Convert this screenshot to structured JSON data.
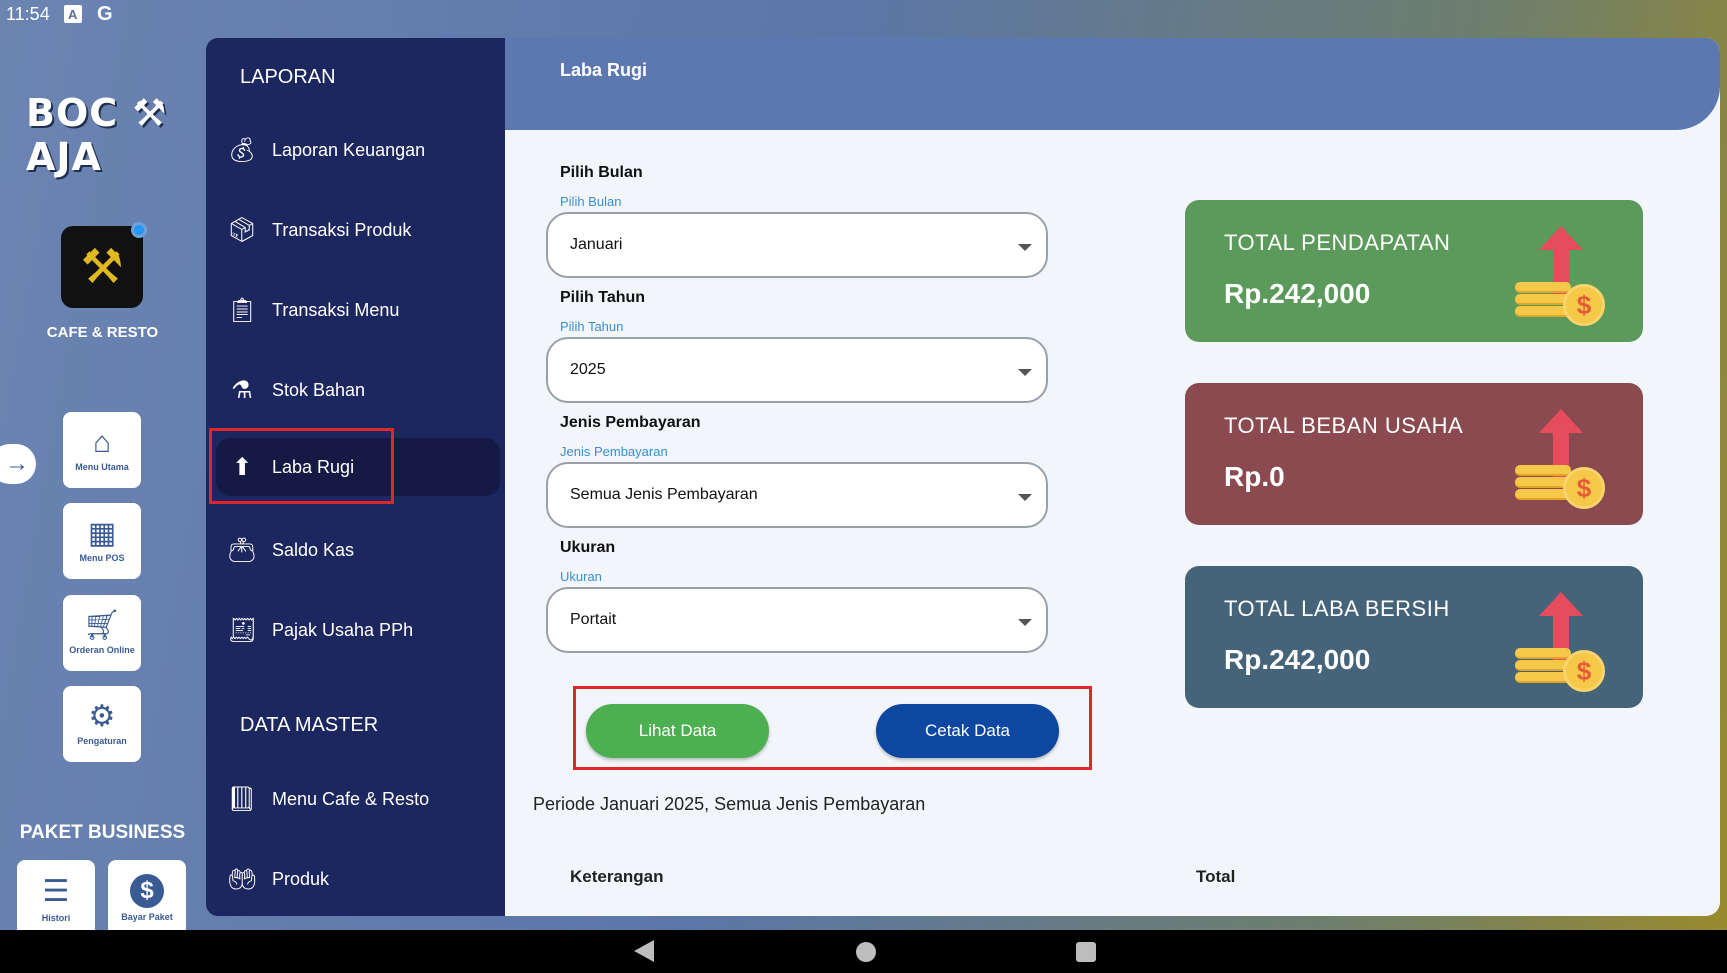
{
  "status_bar": {
    "time": "11:54",
    "icons": [
      "a-icon",
      "google-icon"
    ]
  },
  "rail": {
    "brand": "BOC ⚒ AJA",
    "caption": "CAFE & RESTO",
    "tiles": [
      {
        "label": "Menu Utama",
        "icon": "home-icon"
      },
      {
        "label": "Menu POS",
        "icon": "store-icon"
      },
      {
        "label": "Orderan Online",
        "icon": "cart-icon"
      },
      {
        "label": "Pengaturan",
        "icon": "gear-icon"
      }
    ],
    "paket": "PAKET BUSINESS",
    "bottom_tiles": [
      {
        "label": "Histori",
        "icon": "list-icon"
      },
      {
        "label": "Bayar Paket",
        "icon": "dollar-icon"
      }
    ]
  },
  "sidebar": {
    "laporan_title": "LAPORAN",
    "laporan_items": [
      {
        "label": "Laporan Keuangan",
        "icon": "money-bag-icon"
      },
      {
        "label": "Transaksi Produk",
        "icon": "box-icon"
      },
      {
        "label": "Transaksi Menu",
        "icon": "menu-board-icon"
      },
      {
        "label": "Stok Bahan",
        "icon": "ingredients-icon"
      },
      {
        "label": "Laba Rugi",
        "icon": "coins-up-icon"
      },
      {
        "label": "Saldo Kas",
        "icon": "wallet-icon"
      },
      {
        "label": "Pajak Usaha PPh",
        "icon": "tax-document-icon"
      }
    ],
    "master_title": "DATA MASTER",
    "master_items": [
      {
        "label": "Menu Cafe & Resto",
        "icon": "menu-book-icon"
      },
      {
        "label": "Produk",
        "icon": "product-hands-icon"
      }
    ]
  },
  "main": {
    "title": "Laba Rugi",
    "fields": {
      "bulan": {
        "label": "Pilih Bulan",
        "float": "Pilih Bulan",
        "value": "Januari"
      },
      "tahun": {
        "label": "Pilih Tahun",
        "float": "Pilih Tahun",
        "value": "2025"
      },
      "pembayaran": {
        "label": "Jenis Pembayaran",
        "float": "Jenis Pembayaran",
        "value": "Semua Jenis Pembayaran"
      },
      "ukuran": {
        "label": "Ukuran",
        "float": "Ukuran",
        "value": "Portait"
      }
    },
    "buttons": {
      "lihat": "Lihat Data",
      "cetak": "Cetak Data"
    },
    "periode": "Periode Januari 2025, Semua Jenis Pembayaran",
    "table_headers": {
      "keterangan": "Keterangan",
      "total": "Total"
    },
    "cards": [
      {
        "title": "TOTAL PENDAPATAN",
        "value": "Rp.242,000",
        "color": "#5b9a5a"
      },
      {
        "title": "TOTAL BEBAN USAHA",
        "value": "Rp.0",
        "color": "#8b4a4f"
      },
      {
        "title": "TOTAL LABA BERSIH",
        "value": "Rp.242,000",
        "color": "#456379"
      }
    ]
  },
  "colors": {
    "sidebar": "#1c2760",
    "header": "#5b78b0",
    "accent_green": "#4caf50",
    "accent_blue": "#0d47a1",
    "highlight_red": "#e0262a"
  }
}
